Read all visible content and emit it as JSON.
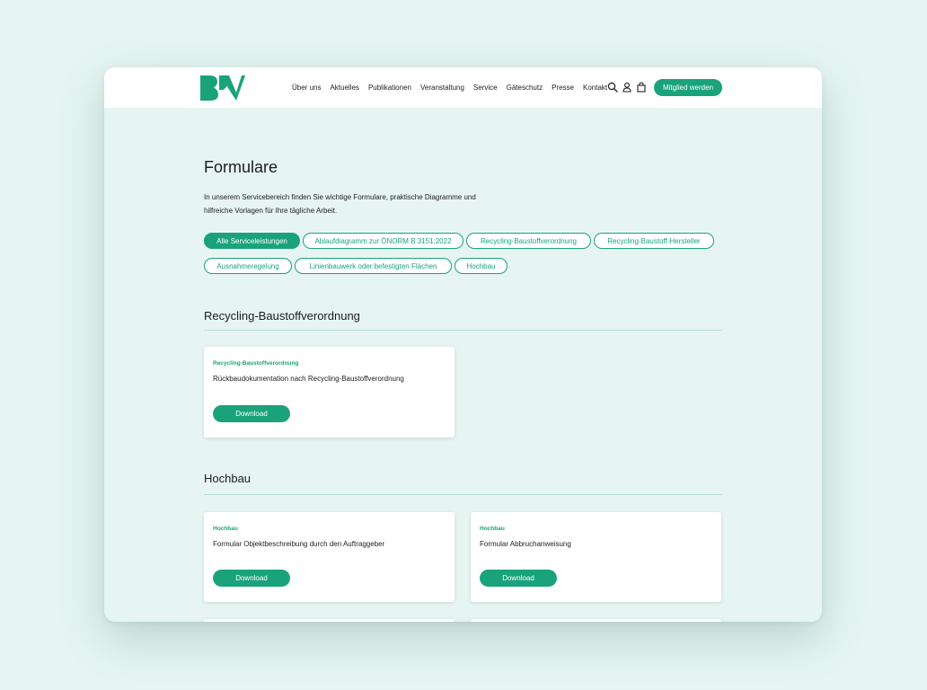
{
  "header": {
    "logo_alt": "BRV",
    "nav": [
      "Über uns",
      "Aktuelles",
      "Publikationen",
      "Veranstaltung",
      "Service",
      "Gäteschutz",
      "Presse",
      "Kontakt"
    ],
    "cta_label": "Mitglied werden",
    "icons": [
      "search-icon",
      "user-icon",
      "bag-icon"
    ]
  },
  "page": {
    "title": "Formulare",
    "intro_line1": "In unserem Servicebereich finden Sie wichtige Formulare, praktische Diagramme und",
    "intro_line2": "hilfreiche Vorlagen für Ihre tägliche Arbeit."
  },
  "filters": [
    "Alle Serviceleistungen",
    "Ablaufdiagramm zur ÖNORM B 3151:2022",
    "Recycling-Baustoffverordnung",
    "Recycling-Baustoff-Hersteller",
    "Ausnahmeregelung",
    "Linienbauwerk oder befestigten Flächen",
    "Hochbau"
  ],
  "active_filter": "Alle Serviceleistungen",
  "sections": [
    {
      "title": "Recycling-Baustoffverordnung",
      "cards": [
        {
          "tag": "Recycling-Baustoffverordnung",
          "title": "Rückbaudokumentation nach Recycling-Baustoffverordnung",
          "button": "Download"
        }
      ]
    },
    {
      "title": "Hochbau",
      "cards": [
        {
          "tag": "Hochbau",
          "title": "Formular Objektbeschreibung durch den Auftraggeber",
          "button": "Download"
        },
        {
          "tag": "Hochbau",
          "title": "Formular Abbruchanweisung",
          "button": "Download"
        }
      ]
    }
  ],
  "colors": {
    "accent": "#1aa37a",
    "background": "#e6f5f2",
    "text": "#1d1d1b"
  }
}
